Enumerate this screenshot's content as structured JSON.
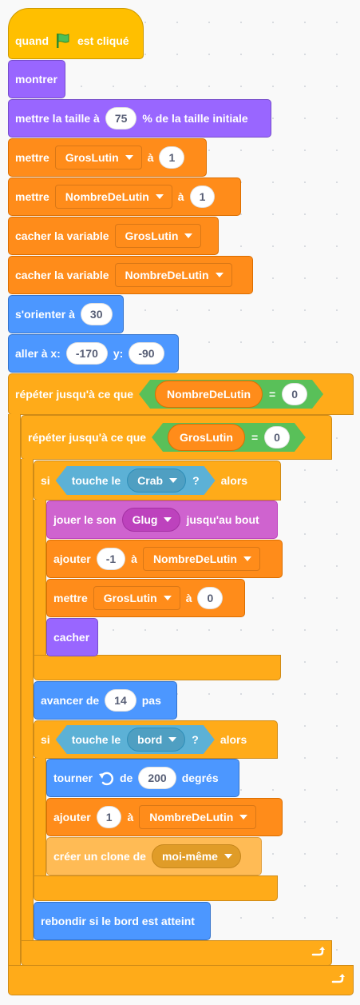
{
  "hat": {
    "prefix": "quand",
    "suffix": "est cliqué",
    "icon": "green-flag-icon"
  },
  "show": "montrer",
  "size": {
    "label": "mettre la taille à",
    "value": "75",
    "suffix": "% de la taille initiale"
  },
  "set1": {
    "label": "mettre",
    "var": "GrosLutin",
    "to": "à",
    "value": "1"
  },
  "set2": {
    "label": "mettre",
    "var": "NombreDeLutin",
    "to": "à",
    "value": "1"
  },
  "hide1": {
    "label": "cacher la variable",
    "var": "GrosLutin"
  },
  "hide2": {
    "label": "cacher la variable",
    "var": "NombreDeLutin"
  },
  "orient": {
    "label": "s'orienter à",
    "value": "30"
  },
  "goto": {
    "label": "aller à x:",
    "x": "-170",
    "ylabel": "y:",
    "y": "-90"
  },
  "repeat_outer": {
    "label": "répéter jusqu'à ce que",
    "var": "NombreDeLutin",
    "eq": "=",
    "value": "0"
  },
  "repeat_inner": {
    "label": "répéter jusqu'à ce que",
    "var": "GrosLutin",
    "eq": "=",
    "value": "0"
  },
  "if1": {
    "si": "si",
    "touch": "touche le",
    "target": "Crab",
    "q": "?",
    "alors": "alors"
  },
  "play": {
    "label": "jouer le son",
    "sound": "Glug",
    "suffix": "jusqu'au bout"
  },
  "add1": {
    "label": "ajouter",
    "value": "-1",
    "to": "à",
    "var": "NombreDeLutin"
  },
  "set3": {
    "label": "mettre",
    "var": "GrosLutin",
    "to": "à",
    "value": "0"
  },
  "hide": "cacher",
  "move": {
    "label": "avancer de",
    "value": "14",
    "suffix": "pas"
  },
  "if2": {
    "si": "si",
    "touch": "touche le",
    "target": "bord",
    "q": "?",
    "alors": "alors"
  },
  "turn": {
    "label": "tourner",
    "icon": "rotate-left-icon",
    "de": "de",
    "value": "200",
    "suffix": "degrés"
  },
  "add2": {
    "label": "ajouter",
    "value": "1",
    "to": "à",
    "var": "NombreDeLutin"
  },
  "clone": {
    "label": "créer un clone de",
    "target": "moi-même"
  },
  "bounce": "rebondir si le bord est atteint",
  "colors": {
    "events": "#ffbf00",
    "looks": "#9966ff",
    "variables": "#ff8c1a",
    "motion": "#4c97ff",
    "control": "#ffab19",
    "sound": "#cf63cf",
    "sensing": "#5cb1d6",
    "operators": "#59c059"
  }
}
